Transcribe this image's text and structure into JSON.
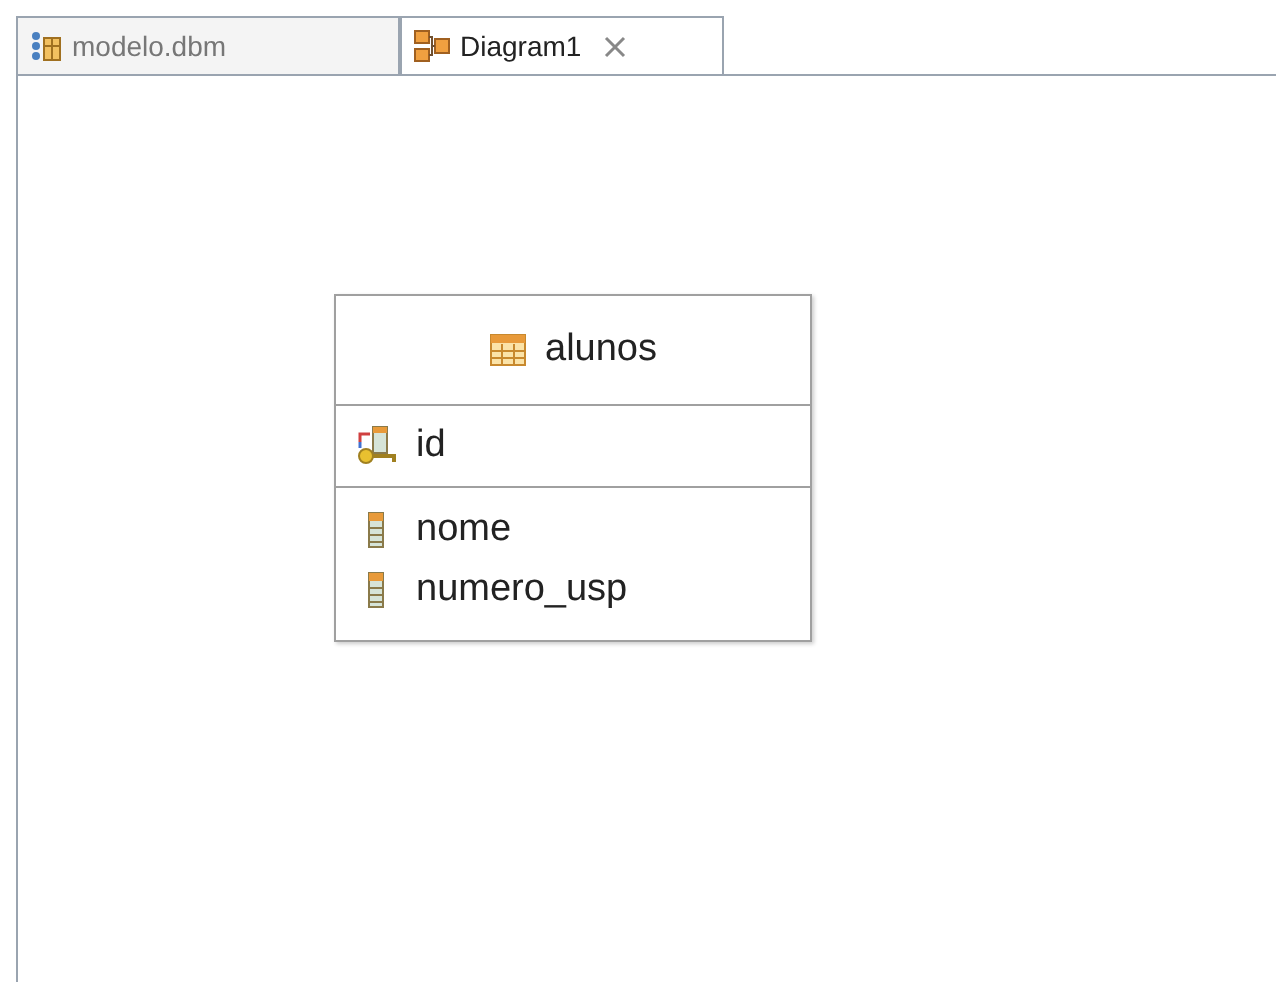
{
  "tabs": [
    {
      "label": "modelo.dbm",
      "selected": false,
      "closable": false
    },
    {
      "label": "Diagram1",
      "selected": true,
      "closable": true
    }
  ],
  "table": {
    "name": "alunos",
    "columns": [
      {
        "name": "id",
        "kind": "primary_key"
      },
      {
        "name": "nome",
        "kind": "column"
      },
      {
        "name": "numero_usp",
        "kind": "column"
      }
    ]
  }
}
